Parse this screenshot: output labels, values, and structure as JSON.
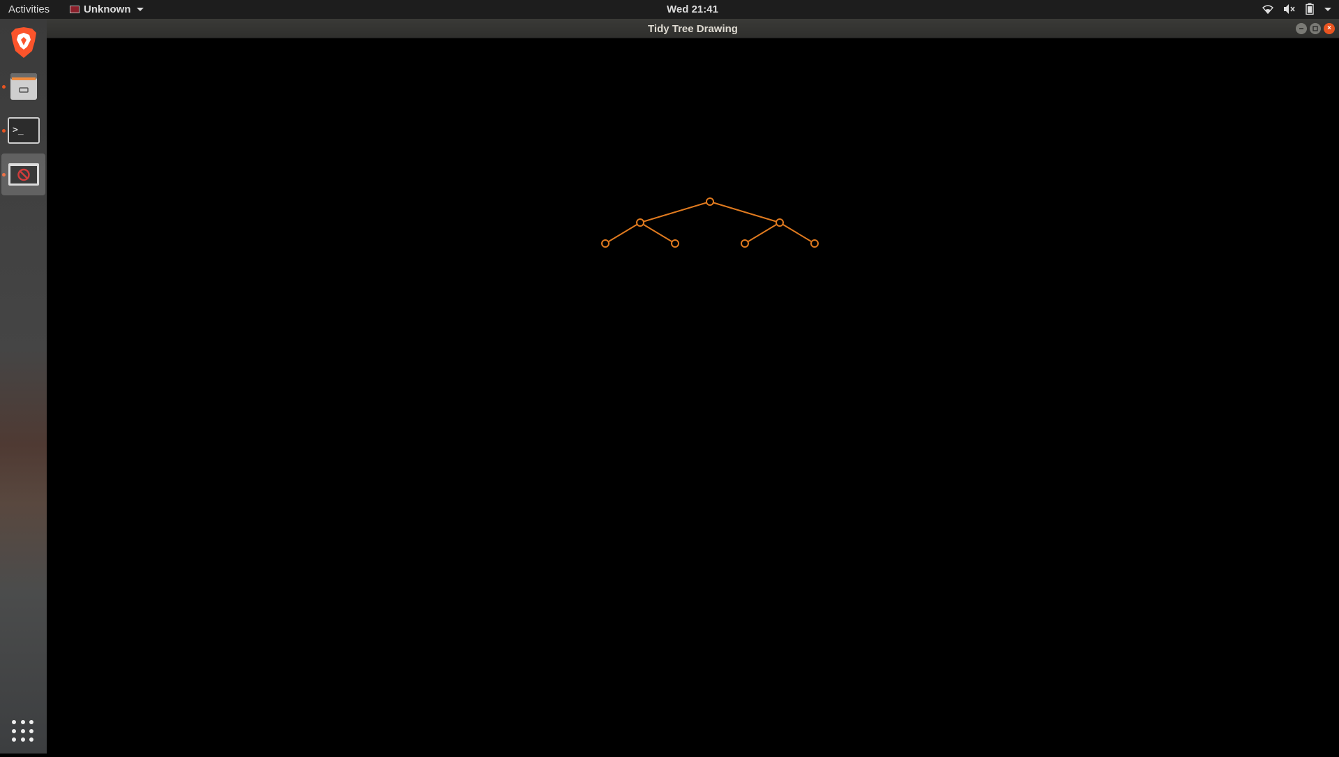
{
  "topbar": {
    "activities": "Activities",
    "app_menu_label": "Unknown",
    "clock": "Wed 21:41",
    "tray_icons": [
      "wifi-icon",
      "volume-muted-icon",
      "battery-icon",
      "chevron-down-icon"
    ]
  },
  "dock": {
    "items": [
      {
        "name": "brave-browser",
        "icon": "brave-lion-icon",
        "running": false
      },
      {
        "name": "files",
        "icon": "file-cabinet-icon",
        "running": true
      },
      {
        "name": "terminal",
        "icon": "terminal-icon",
        "running": true,
        "glyph": ">_"
      },
      {
        "name": "tidy-tree-app",
        "icon": "app-window-icon",
        "running": true,
        "active": true
      }
    ],
    "show_apps_icon": "grid-icon"
  },
  "window": {
    "title": "Tidy Tree Drawing",
    "close_glyph": "×"
  },
  "tree": {
    "color": "#e07a1f",
    "nodes": [
      {
        "id": "root",
        "depth": 0,
        "order": 3
      },
      {
        "id": "l",
        "depth": 1,
        "order": 1
      },
      {
        "id": "r",
        "depth": 1,
        "order": 5
      },
      {
        "id": "ll",
        "depth": 2,
        "order": 0
      },
      {
        "id": "lr",
        "depth": 2,
        "order": 2
      },
      {
        "id": "rl",
        "depth": 2,
        "order": 4
      },
      {
        "id": "rr",
        "depth": 2,
        "order": 6
      }
    ],
    "edges": [
      [
        "root",
        "l"
      ],
      [
        "root",
        "r"
      ],
      [
        "l",
        "ll"
      ],
      [
        "l",
        "lr"
      ],
      [
        "r",
        "rl"
      ],
      [
        "r",
        "rr"
      ]
    ]
  }
}
